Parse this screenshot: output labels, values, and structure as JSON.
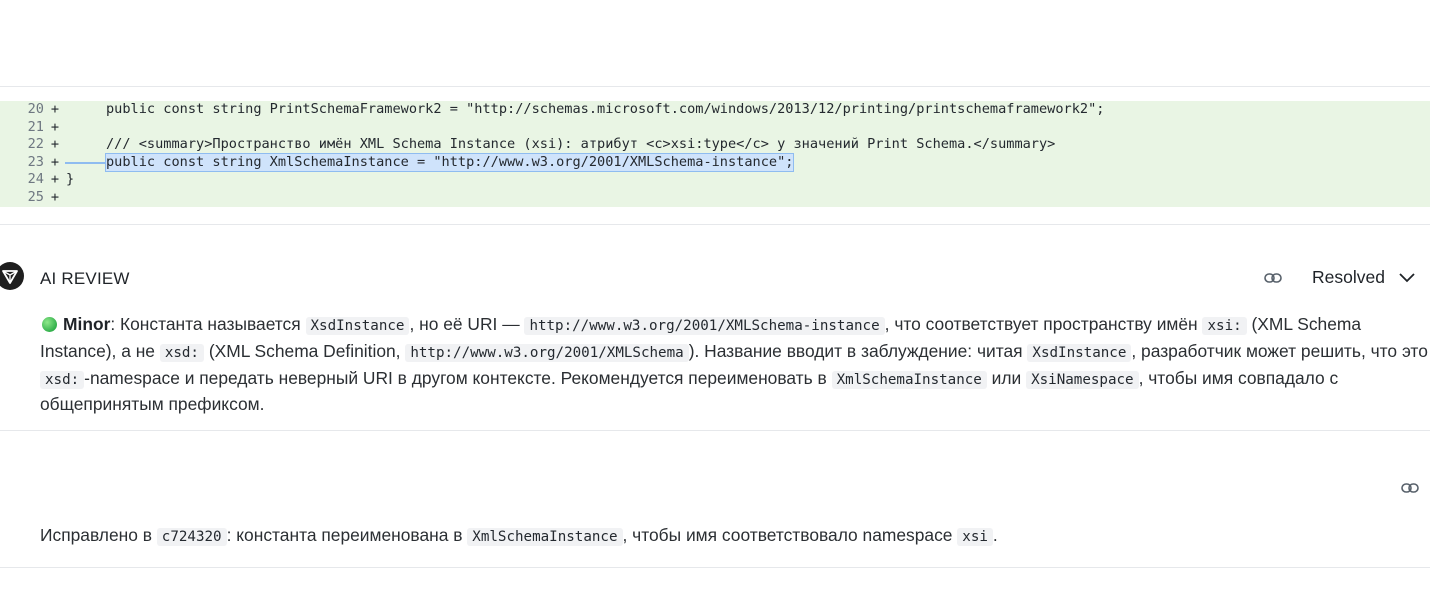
{
  "diff": {
    "lines": [
      {
        "num": "20",
        "sign": "+",
        "code": "public const string PrintSchemaFramework2 = \"http://schemas.microsoft.com/windows/2013/12/printing/printschemaframework2\";"
      },
      {
        "num": "21",
        "sign": "+",
        "code": ""
      },
      {
        "num": "22",
        "sign": "+",
        "code": "/// <summary>Пространство имён XML Schema Instance (xsi): атрибут <c>xsi:type</c> у значений Print Schema.</summary>"
      },
      {
        "num": "23",
        "sign": "+",
        "code": "public const string XmlSchemaInstance = \"http://www.w3.org/2001/XMLSchema-instance\";"
      },
      {
        "num": "24",
        "sign": "+",
        "code": "}"
      },
      {
        "num": "25",
        "sign": "+",
        "code": ""
      }
    ]
  },
  "review": {
    "title": "AI REVIEW",
    "status": "Resolved",
    "severity": "Minor",
    "t1": ": Константа называется ",
    "c1": "XsdInstance",
    "t2": ", но её URI — ",
    "c2": "http://www.w3.org/2001/XMLSchema-instance",
    "t3": ", что соответствует пространству имён ",
    "c3": "xsi:",
    "t4": " (XML Schema Instance), а не ",
    "c4": "xsd:",
    "t5": " (XML Schema Definition, ",
    "c5": "http://www.w3.org/2001/XMLSchema",
    "t6": "). Название вводит в заблуждение: читая ",
    "c6": "XsdInstance",
    "t7": ", разработчик может решить, что это ",
    "c7": "xsd:",
    "t8": "-namespace и передать неверный URI в другом контексте. Рекомендуется переименовать в ",
    "c8": "XmlSchemaInstance",
    "t9": " или ",
    "c9": "XsiNamespace",
    "t10": ", чтобы имя совпадало с общепринятым префиксом."
  },
  "reply": {
    "t1": "Исправлено в ",
    "c1": "c724320",
    "t2": ": константа переименована в ",
    "c2": "XmlSchemaInstance",
    "t3": ", чтобы имя соответствовало namespace ",
    "c3": "xsi",
    "t4": "."
  },
  "colors": {
    "diff_added_bg": "#e9f5e4",
    "selection_bg": "#cfe3fb",
    "severity_minor": "#33b04c"
  }
}
